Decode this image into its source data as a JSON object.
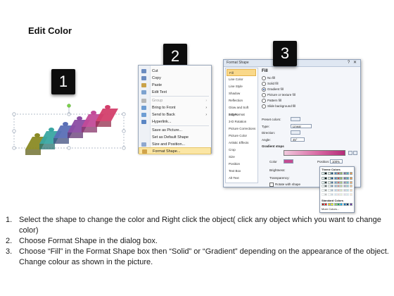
{
  "title": "Edit Color",
  "steps": {
    "one": "1",
    "two": "2",
    "three": "3"
  },
  "puzzle_colors": [
    "#8a8a24",
    "#3aa6a2",
    "#5a6fb6",
    "#8b4ca3",
    "#c24a98",
    "#d33f6c"
  ],
  "context_menu": {
    "items": [
      {
        "label": "Cut",
        "icon": "scissors-icon",
        "color": "#6c8cc0"
      },
      {
        "label": "Copy",
        "icon": "copy-icon",
        "color": "#6c8cc0"
      },
      {
        "label": "Paste",
        "icon": "paste-icon",
        "color": "#c9a24a"
      },
      {
        "label": "Edit Text",
        "icon": "edit-text-icon",
        "color": "#7da2cf"
      },
      {
        "label": "Group",
        "icon": "group-icon",
        "color": "#b7b7b7",
        "arrow": "›",
        "disabled": true
      },
      {
        "label": "Bring to Front",
        "icon": "bring-front-icon",
        "color": "#6e9dd3",
        "arrow": "›"
      },
      {
        "label": "Send to Back",
        "icon": "send-back-icon",
        "color": "#6e9dd3",
        "arrow": "›"
      },
      {
        "label": "Hyperlink...",
        "icon": "hyperlink-icon",
        "color": "#5b86c4"
      },
      {
        "label": "Save as Picture...",
        "icon": "",
        "color": ""
      },
      {
        "label": "Set as Default Shape",
        "icon": "",
        "color": ""
      },
      {
        "label": "Size and Position...",
        "icon": "size-position-icon",
        "color": "#8fa8cf"
      },
      {
        "label": "Format Shape...",
        "icon": "format-shape-icon",
        "color": "#d0a34a",
        "highlight": true
      }
    ]
  },
  "dialog": {
    "title": "Format Shape",
    "help": "?",
    "close": "✕",
    "nav": [
      "Fill",
      "Line Color",
      "Line Style",
      "Shadow",
      "Reflection",
      "Glow and Soft Edges",
      "3-D Format",
      "3-D Rotation",
      "Picture Corrections",
      "Picture Color",
      "Artistic Effects",
      "Crop",
      "Size",
      "Position",
      "Text Box",
      "Alt Text"
    ],
    "pane_heading": "Fill",
    "fill_options": [
      {
        "label": "No fill",
        "on": false
      },
      {
        "label": "Solid fill",
        "on": false
      },
      {
        "label": "Gradient fill",
        "on": true
      },
      {
        "label": "Picture or texture fill",
        "on": false
      },
      {
        "label": "Pattern fill",
        "on": false
      },
      {
        "label": "Slide background fill",
        "on": false
      }
    ],
    "preset_colors_label": "Preset colors:",
    "type_label": "Type:",
    "type_value": "Linear",
    "direction_label": "Direction:",
    "angle_label": "Angle:",
    "angle_value": "45°",
    "gradient_stops_label": "Gradient stops",
    "color_label": "Color",
    "position_label": "Position:",
    "position_value": "100%",
    "brightness_label": "Brightness:",
    "transparency_label": "Transparency:",
    "rotate_label": "Rotate with shape",
    "palette": {
      "theme_label": "Theme Colors",
      "standard_label": "Standard Colors",
      "more_label": "More Colors...",
      "theme_row": [
        "#ffffff",
        "#000000",
        "#eeece1",
        "#1f497d",
        "#4f81bd",
        "#c0504d",
        "#9bbb59",
        "#8064a2",
        "#4bacc6",
        "#f79646"
      ],
      "standard_row": [
        "#c00000",
        "#ff0000",
        "#ffc000",
        "#ffff00",
        "#92d050",
        "#00b050",
        "#00b0f0",
        "#0070c0",
        "#002060",
        "#7030a0"
      ]
    }
  },
  "instructions": [
    {
      "num": "1.",
      "text": "Select the shape to change the color and Right click the object( click any object which you want to change color)"
    },
    {
      "num": "2.",
      "text": "Choose Format Shape in the dialog box."
    },
    {
      "num": "3.",
      "text": "Choose “Fill” in the Format Shape box then “Solid” or “Gradient” depending on the appearance of the object. Change colour as shown in the picture."
    }
  ]
}
